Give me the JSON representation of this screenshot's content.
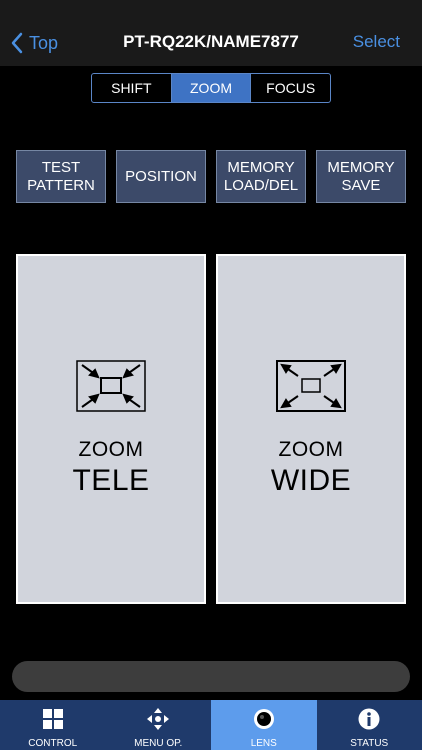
{
  "nav": {
    "back_label": "Top",
    "title": "PT-RQ22K/NAME7877",
    "action_label": "Select"
  },
  "segments": [
    {
      "label": "SHIFT",
      "active": false
    },
    {
      "label": "ZOOM",
      "active": true
    },
    {
      "label": "FOCUS",
      "active": false
    }
  ],
  "function_buttons": [
    {
      "label": "TEST\nPATTERN"
    },
    {
      "label": "POSITION"
    },
    {
      "label": "MEMORY\nLOAD/DEL"
    },
    {
      "label": "MEMORY\nSAVE"
    }
  ],
  "zoom_pads": {
    "tele": {
      "line1": "ZOOM",
      "line2": "TELE",
      "icon": "zoom-in-arrows-icon"
    },
    "wide": {
      "line1": "ZOOM",
      "line2": "WIDE",
      "icon": "zoom-out-arrows-icon"
    }
  },
  "tabs": [
    {
      "label": "CONTROL",
      "icon": "grid-icon",
      "active": false
    },
    {
      "label": "MENU OP.",
      "icon": "move-arrows-icon",
      "active": false
    },
    {
      "label": "LENS",
      "icon": "lens-icon",
      "active": true
    },
    {
      "label": "STATUS",
      "icon": "info-icon",
      "active": false
    }
  ],
  "colors": {
    "accent": "#4a90e2",
    "segment_active": "#3e73c4",
    "button_bg": "#3c4a69",
    "pad_bg": "#d1d4dc",
    "tabbar_bg": "#1f3a6b",
    "tab_active": "#5d9cec"
  }
}
